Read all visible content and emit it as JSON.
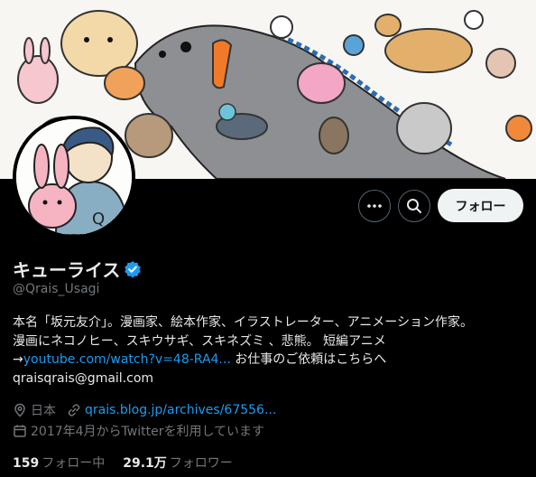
{
  "profile": {
    "display_name": "キューライス",
    "handle": "@Qrais_Usagi",
    "follow_label": "フォロー",
    "verified_icon": "verified-badge-icon"
  },
  "bio": {
    "line1": "本名「坂元友介」。漫画家、絵本作家、イラストレーター、アニメーション作家。",
    "line2": "漫画にネコノヒー、スキウサギ、スキネズミ 、悲熊。 短編アニメ",
    "line3_prefix": "→",
    "line3_link": "youtube.com/watch?v=48-RA4...",
    "line3_suffix": " お仕事のご依頼はこちらへ",
    "line4": "qraisqrais@gmail.com"
  },
  "meta": {
    "location": "日本",
    "website": "qrais.blog.jp/archives/67556...",
    "joined": "2017年4月からTwitterを利用しています"
  },
  "stats": {
    "following_count": "159",
    "following_label": "フォロー中",
    "followers_count": "29.1万",
    "followers_label": "フォロワー"
  },
  "colors": {
    "accent": "#1d9bf0",
    "background": "#000000",
    "secondary_text": "#71767b"
  }
}
